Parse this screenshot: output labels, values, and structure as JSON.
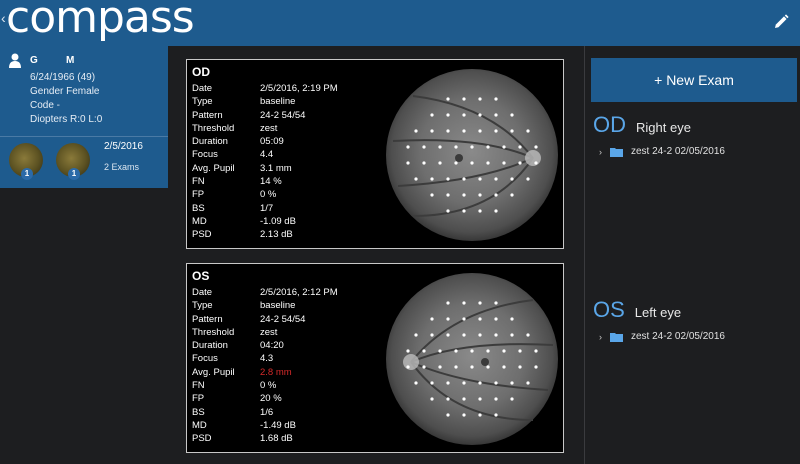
{
  "app": {
    "logo": "compass",
    "back_glyph": "‹"
  },
  "patient": {
    "initial_first": "G",
    "initial_last": "M",
    "dob_line": "6/24/1966 (49)",
    "gender_line": "Gender  Female",
    "code_line": "Code  -",
    "diopters_line": "Diopters  R:0  L:0",
    "visit_date": "2/5/2016",
    "visit_count": "2 Exams",
    "thumb_badges": [
      "1",
      "1"
    ]
  },
  "exams": {
    "labels": [
      "Date",
      "Type",
      "Pattern",
      "Threshold",
      "Duration",
      "Focus",
      "Avg. Pupil",
      "FN",
      "FP",
      "BS",
      "MD",
      "PSD"
    ],
    "od": {
      "title": "OD",
      "values": [
        "2/5/2016, 2:19 PM",
        "baseline",
        "24-2 54/54",
        "zest",
        "05:09",
        "4.4",
        "3.1 mm",
        "14 %",
        "0 %",
        "1/7",
        "-1.09 dB",
        "2.13 dB"
      ]
    },
    "os": {
      "title": "OS",
      "values": [
        "2/5/2016, 2:12 PM",
        "baseline",
        "24-2 54/54",
        "zest",
        "04:20",
        "4.3",
        "2.8 mm",
        "0 %",
        "20 %",
        "1/6",
        "-1.49 dB",
        "1.68 dB"
      ],
      "warn_color": "#d42a2a"
    }
  },
  "right": {
    "new_exam_label": "+ New Exam",
    "od_code": "OD",
    "od_name": "Right eye",
    "od_item": "zest 24-2 02/05/2016",
    "os_code": "OS",
    "os_name": "Left eye",
    "os_item": "zest 24-2 02/05/2016"
  },
  "colors": {
    "brand": "#1e5b8e",
    "accent": "#5aa6e8",
    "background": "#1d1e20",
    "folder": "#5aa6e8"
  },
  "icons": [
    "pencil-icon",
    "person-icon",
    "folder-icon",
    "chevron-right-icon"
  ]
}
